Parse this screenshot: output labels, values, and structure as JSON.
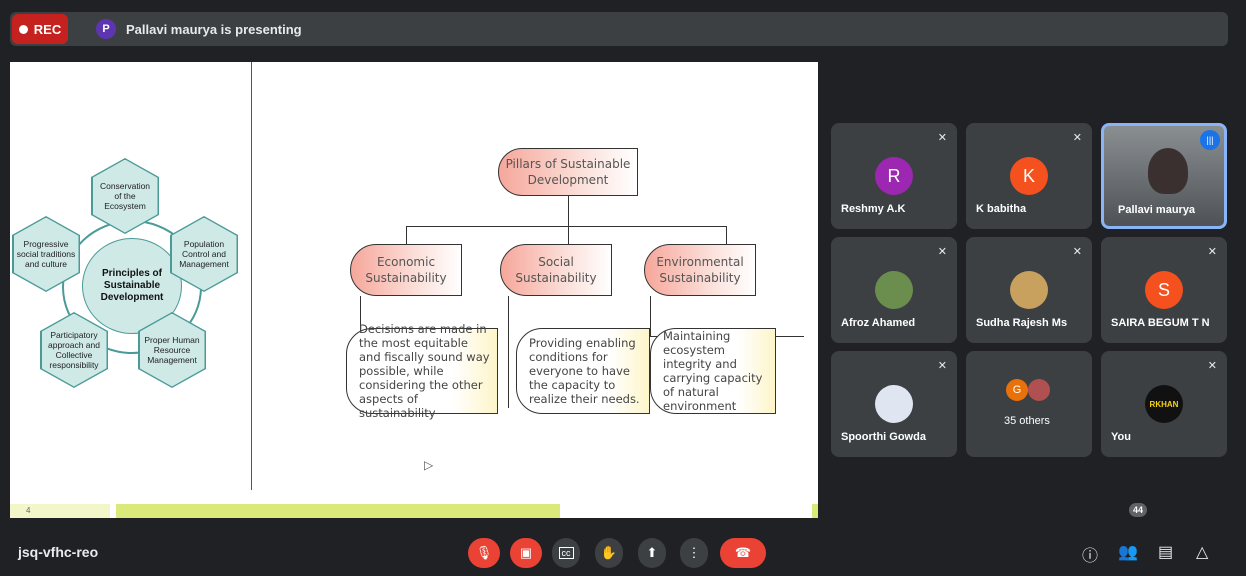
{
  "topbar": {
    "rec_label": "REC",
    "presenter_initial": "P",
    "presenter_text": "Pallavi maurya is presenting"
  },
  "slide": {
    "page_number": "4",
    "principles": {
      "center": "Principles of Sustainable Development",
      "hexes": [
        "Conservation of the Ecosystem",
        "Population Control and Management",
        "Proper Human Resource Management",
        "Participatory approach and Collective responsibility",
        "Progressive social traditions and culture"
      ]
    },
    "pillars": {
      "title": "Pillars of Sustainable Development",
      "economic": "Economic Sustainability",
      "social": "Social Sustainability",
      "environmental": "Environmental Sustainability",
      "economic_desc": "Decisions are made in the most equitable and fiscally sound way possible, while considering the other aspects of sustainability",
      "social_desc": "Providing enabling conditions for everyone to have the capacity to realize their needs.",
      "environmental_desc": "Maintaining ecosystem integrity and carrying capacity of natural environment"
    }
  },
  "participants": [
    {
      "name": "Reshmy A.K",
      "initial": "R",
      "color": "#9c27b0"
    },
    {
      "name": "K babitha",
      "initial": "K",
      "color": "#f4511e"
    },
    {
      "name": "Pallavi maurya"
    },
    {
      "name": "Afroz Ahamed"
    },
    {
      "name": "Sudha Rajesh Ms"
    },
    {
      "name": "SAIRA BEGUM T N",
      "initial": "S",
      "color": "#f4511e"
    },
    {
      "name": "Spoorthi Gowda"
    },
    {
      "name": "35 others",
      "initial": "G"
    },
    {
      "name": "You",
      "avatar_text": "RKHAN"
    }
  ],
  "bottom": {
    "meeting_id": "jsq-vfhc-reo",
    "people_count": "44"
  },
  "icons": [
    "mic-off-icon",
    "camera-off-icon",
    "captions-icon",
    "raise-hand-icon",
    "present-icon",
    "more-icon",
    "end-call-icon",
    "info-icon",
    "people-icon",
    "chat-icon",
    "activities-icon"
  ]
}
